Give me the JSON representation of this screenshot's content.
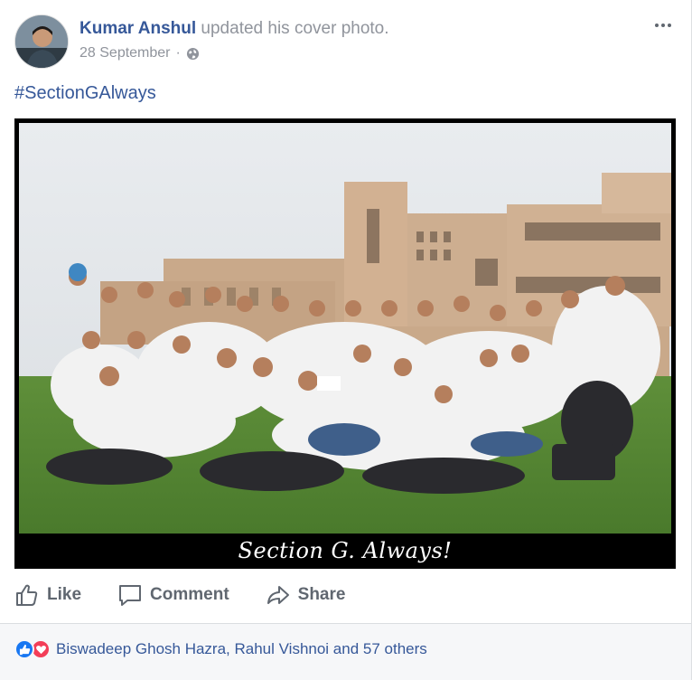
{
  "post": {
    "author": "Kumar Anshul",
    "action_text": "updated his cover photo.",
    "date": "28 September",
    "date_separator": "·",
    "privacy_icon": "globe-icon",
    "more_icon": "more-dots-icon",
    "caption": "#SectionGAlways",
    "photo_caption": "Section G. Always!"
  },
  "actions": {
    "like_label": "Like",
    "comment_label": "Comment",
    "share_label": "Share"
  },
  "reactions": {
    "icons": [
      "like-reaction-icon",
      "love-reaction-icon"
    ],
    "summary": "Biswadeep Ghosh Hazra, Rahul Vishnoi and 57 others"
  },
  "colors": {
    "link": "#365899",
    "meta": "#90949c",
    "action": "#606770",
    "like": "#1877f2",
    "love": "#f33e58"
  }
}
